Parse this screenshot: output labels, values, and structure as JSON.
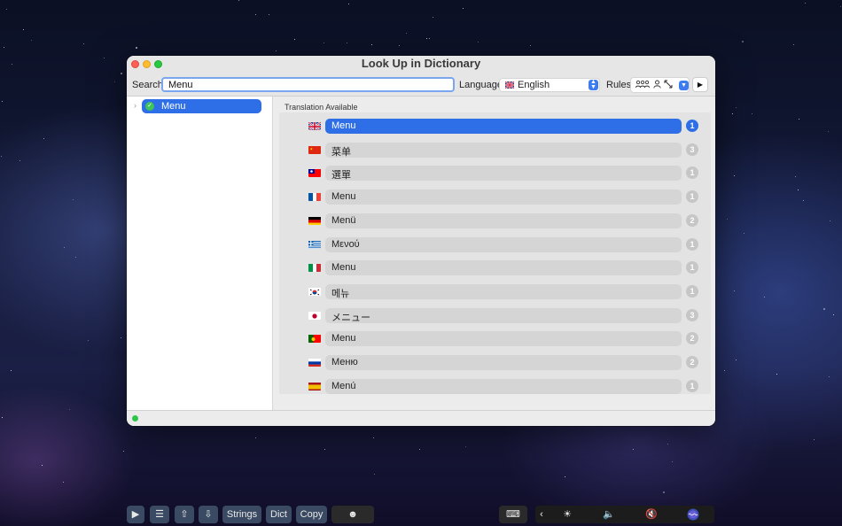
{
  "window": {
    "title": "Look Up in Dictionary"
  },
  "toolbar": {
    "search_label": "Search",
    "search_value": "Menu",
    "language_label": "Language",
    "language_value": "English",
    "language_flag": "uk-flag-icon",
    "rules_label": "Rules",
    "rule_icons": [
      "group-icon",
      "person-icon",
      "expand-icon"
    ],
    "run_icon": "play-icon"
  },
  "sidebar": {
    "items": [
      {
        "label": "Menu",
        "status": "translated"
      }
    ]
  },
  "main": {
    "section_header": "Translation Available",
    "rows": [
      {
        "flag": "uk",
        "text": "Menu",
        "count": "1",
        "selected": true
      },
      {
        "flag": "cn",
        "text": "菜单",
        "count": "3"
      },
      {
        "flag": "tw",
        "text": "選單",
        "count": "1"
      },
      {
        "flag": "fr",
        "text": "Menu",
        "count": "1"
      },
      {
        "flag": "de",
        "text": "Menü",
        "count": "2"
      },
      {
        "flag": "gr",
        "text": "Μενού",
        "count": "1"
      },
      {
        "flag": "it",
        "text": "Menu",
        "count": "1"
      },
      {
        "flag": "kr",
        "text": "메뉴",
        "count": "1"
      },
      {
        "flag": "jp",
        "text": "メニュー",
        "count": "3"
      },
      {
        "flag": "pt",
        "text": "Menu",
        "count": "2"
      },
      {
        "flag": "ru",
        "text": "Меню",
        "count": "2"
      },
      {
        "flag": "es",
        "text": "Menú",
        "count": "1"
      }
    ]
  },
  "touchbar": {
    "strings_label": "Strings",
    "dict_label": "Dict",
    "copy_label": "Copy",
    "icons": [
      "play-icon",
      "list-icon",
      "upload-icon",
      "download-icon",
      "emoji-icon",
      "keyboard-icon",
      "chevron-left-icon",
      "brightness-icon",
      "volume-icon",
      "mute-icon",
      "siri-icon"
    ]
  },
  "colors": {
    "accent": "#2e6ee6",
    "status_green": "#2fc548"
  }
}
